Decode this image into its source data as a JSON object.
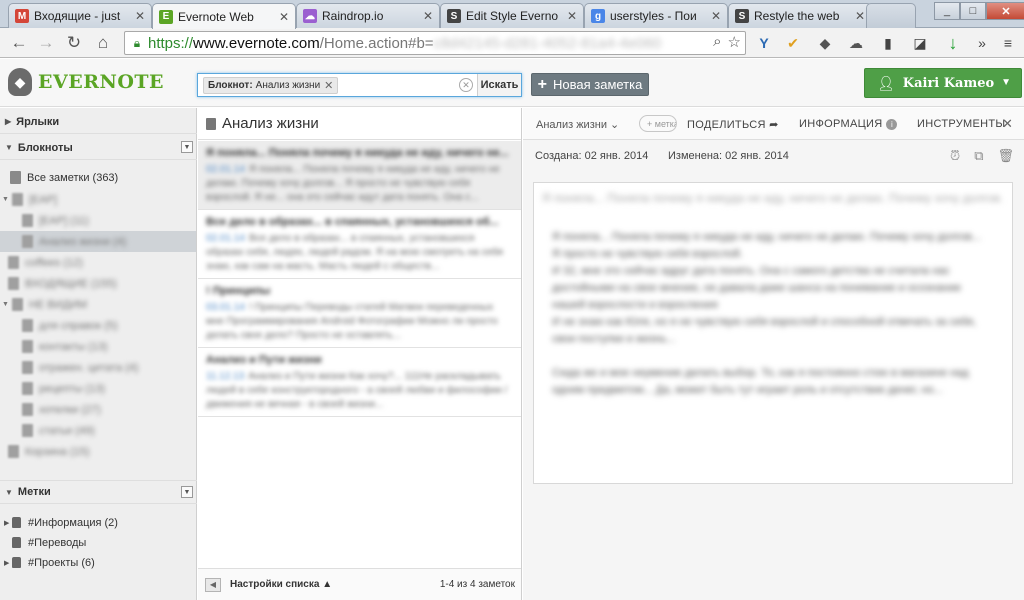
{
  "browser": {
    "tabs": [
      {
        "label": "Входящие - just",
        "icon": "gmail-icon",
        "color": "#d44638",
        "glyph": "M"
      },
      {
        "label": "Evernote Web",
        "icon": "evernote-icon",
        "color": "#5ba525",
        "glyph": "E",
        "active": true
      },
      {
        "label": "Raindrop.io",
        "icon": "raindrop-icon",
        "color": "#9b5fd0",
        "glyph": "☁"
      },
      {
        "label": "Edit Style Everno",
        "icon": "stylish-icon",
        "color": "#444444",
        "glyph": "S"
      },
      {
        "label": "userstyles - Пои",
        "icon": "google-icon",
        "color": "#4a86e8",
        "glyph": "g"
      },
      {
        "label": "Restyle the web",
        "icon": "stylish-icon",
        "color": "#444444",
        "glyph": "S"
      }
    ],
    "url": {
      "scheme": "https://",
      "host": "www.evernote.com",
      "path": "/Home.action#b=",
      "hidden": "c8d42145-d281-4052-81a4-4e060"
    }
  },
  "header": {
    "logo_text": "EVERNOTE",
    "search": {
      "chip_label": "Блокнот:",
      "chip_value": "Анализ жизни",
      "button": "Искать"
    },
    "new_note": "Новая заметка",
    "user_name": "Kairi Kameo"
  },
  "sidebar": {
    "shortcuts": "Ярлыки",
    "notebooks": "Блокноты",
    "all_notes": "Все заметки (363)",
    "notebook_items": [
      {
        "label": "[EAP]",
        "level": 0,
        "stack": true
      },
      {
        "label": "[EAP] (11)",
        "level": 1
      },
      {
        "label": "Анализ жизни (4)",
        "level": 1,
        "selected": true
      },
      {
        "label": "coffees (12)",
        "level": 0
      },
      {
        "label": "ВХОДЯЩИЕ (155)",
        "level": 0
      },
      {
        "label": "НЕ ВИДИМ",
        "level": 0,
        "stack": true
      },
      {
        "label": "для справок (5)",
        "level": 1
      },
      {
        "label": "контакты (13)",
        "level": 1
      },
      {
        "label": "отражен. цитата (4)",
        "level": 1
      },
      {
        "label": "рецепты (13)",
        "level": 1
      },
      {
        "label": "хотелки (27)",
        "level": 1
      },
      {
        "label": "статьи (49)",
        "level": 1
      },
      {
        "label": "Корзина (15)",
        "level": 0
      }
    ],
    "tags": "Метки",
    "tag_items": [
      {
        "label": "#Информация (2)",
        "expandable": true
      },
      {
        "label": "#Переводы",
        "expandable": false
      },
      {
        "label": "#Проекты (6)",
        "expandable": true
      }
    ]
  },
  "notelist": {
    "title": "Анализ жизни",
    "notes": [
      {
        "title": "Я поняла... Поняла почему я никуда не иду, ничего не...",
        "date": "02.01.14",
        "snippet": "Я поняла... Поняла почему я никуда не иду, ничего не делаю. Почему хочу долгов... Я просто не чувствую себя взрослой. Я не... она это сейчас идут дата понять. Она с..."
      },
      {
        "title": "Все дело в образах... в спаянных, установшихся об...",
        "date": "02.01.14",
        "snippet": "Все дело в образах... в спаянных, установшихся образах себя, людях, людей радом. Я на мою смотреть на себя знаю, как сам на масть. Масть людей с обществ..."
      },
      {
        "title": "! Принципы",
        "date": "03.01.14",
        "snippet": "! Принципы Переводы статей Матвеи переведенных мне Программирования Android Фотографии Можно ли просто делать свое дело? Просто не оставлять..."
      },
      {
        "title": "Анализ и Пути жизни",
        "date": "11.12.13",
        "snippet": "Анализ и Пути жизни Как хочу?... 111Не раскладывать людей в себе конструктородного - а своей любви и философии / движения не вечная - в своей жизни..."
      }
    ],
    "settings": "Настройки списка",
    "count": "1-4 из 4 заметок"
  },
  "noteview": {
    "notebook": "Анализ жизни",
    "tag_placeholder": "+ метка",
    "share": "ПОДЕЛИТЬСЯ",
    "info": "ИНФОРМАЦИЯ",
    "tools": "ИНСТРУМЕНТЫ",
    "created": "Создана: 02 янв. 2014",
    "modified": "Изменена: 02 янв. 2014",
    "title": "Я поняла... Поняла почему я никуда не иду, ничего не делаю. Почему хочу долгов...",
    "body": [
      "Я поняла... Поняла почему я никуда не иду, ничего не делаю. Почему хочу долгов...",
      "Я просто не чувствую себя взрослой.",
      "И 32, мне это сейчас вдруг дата понять. Она с самого детства не считала нас достойными на свое мнение, не давала даже шанса на понимание и осознание нашей взрослости и взросления",
      "И не знаю как Юля, но я не чувствую себя взрослой и способной отвечать за себя, свои поступки и жизнь...",
      "",
      "Сюда же и мое неумение делать выбор. То, как я постоянно стою в магазине над одним предметом... Да, может быть тут играет роль и отсутствие денег, но..."
    ]
  }
}
